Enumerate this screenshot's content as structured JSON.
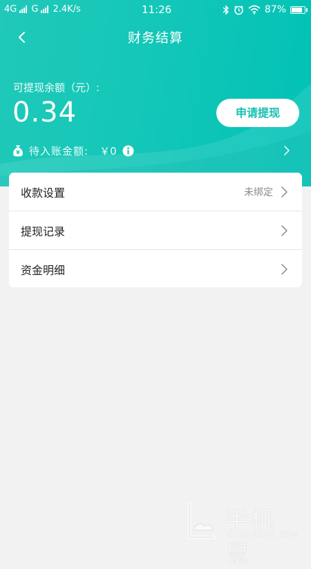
{
  "status_bar": {
    "network_1": "4G",
    "network_2": "G",
    "speed": "2.4K/s",
    "time": "11:26",
    "battery": "87%",
    "battery_level": 0.87
  },
  "header": {
    "title": "财务结算",
    "balance_label": "可提现余额（元）:",
    "balance_value": "0.34",
    "withdraw_button_label": "申请提现",
    "pending_label": "待入账金额:",
    "pending_amount": "￥0"
  },
  "menu": {
    "items": [
      {
        "label": "收款设置",
        "value": "未绑定"
      },
      {
        "label": "提现记录"
      },
      {
        "label": "资金明细"
      }
    ]
  },
  "watermark": {
    "name": "手机鼠",
    "url": "SHOUJISHU.COM"
  },
  "colors": {
    "accent": "#14c7b8",
    "background": "#f2f2f2",
    "card": "#ffffff"
  }
}
